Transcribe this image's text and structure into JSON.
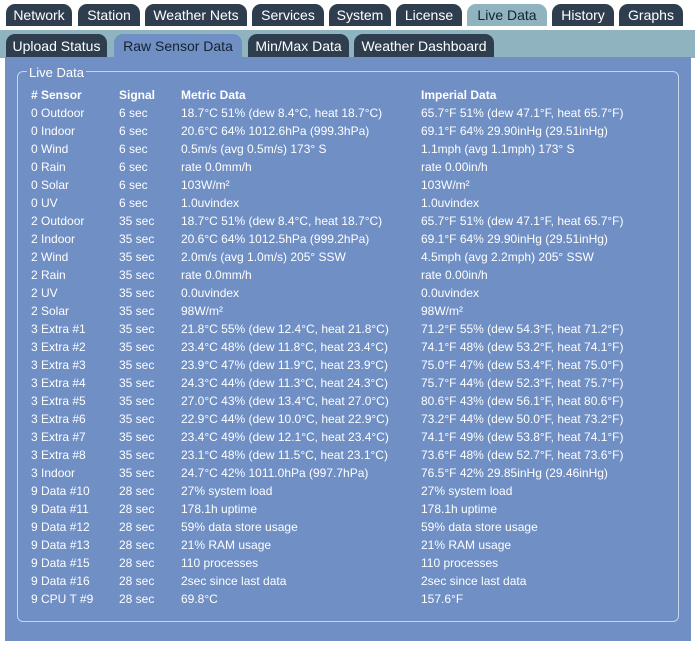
{
  "main_tabs": [
    "Network",
    "Station",
    "Weather Nets",
    "Services",
    "System",
    "License",
    "Live Data",
    "History",
    "Graphs"
  ],
  "active_main_tab": "Live Data",
  "sub_tabs": [
    "Upload Status",
    "Raw Sensor Data",
    "Min/Max Data",
    "Weather Dashboard"
  ],
  "active_sub_tab": "Raw Sensor Data",
  "panel": {
    "legend": "Live Data",
    "headers": {
      "sensor": "# Sensor",
      "signal": "Signal",
      "metric": "Metric Data",
      "imperial": "Imperial Data"
    },
    "rows": [
      {
        "sensor": "0 Outdoor",
        "signal": "6 sec",
        "metric": "18.7°C 51% (dew 8.4°C, heat 18.7°C)",
        "imperial": "65.7°F 51% (dew 47.1°F, heat 65.7°F)"
      },
      {
        "sensor": "0 Indoor",
        "signal": "6 sec",
        "metric": "20.6°C 64% 1012.6hPa (999.3hPa)",
        "imperial": "69.1°F 64% 29.90inHg (29.51inHg)"
      },
      {
        "sensor": "0 Wind",
        "signal": "6 sec",
        "metric": "0.5m/s (avg 0.5m/s) 173° S",
        "imperial": "1.1mph (avg 1.1mph) 173° S"
      },
      {
        "sensor": "0 Rain",
        "signal": "6 sec",
        "metric": "rate 0.0mm/h",
        "imperial": "rate 0.00in/h"
      },
      {
        "sensor": "0 Solar",
        "signal": "6 sec",
        "metric": "103W/m²",
        "imperial": "103W/m²"
      },
      {
        "sensor": "0 UV",
        "signal": "6 sec",
        "metric": "1.0uvindex",
        "imperial": "1.0uvindex"
      },
      {
        "sensor": "2 Outdoor",
        "signal": "35 sec",
        "metric": "18.7°C 51% (dew 8.4°C, heat 18.7°C)",
        "imperial": "65.7°F 51% (dew 47.1°F, heat 65.7°F)"
      },
      {
        "sensor": "2 Indoor",
        "signal": "35 sec",
        "metric": "20.6°C 64% 1012.5hPa (999.2hPa)",
        "imperial": "69.1°F 64% 29.90inHg (29.51inHg)"
      },
      {
        "sensor": "2 Wind",
        "signal": "35 sec",
        "metric": "2.0m/s (avg 1.0m/s) 205° SSW",
        "imperial": "4.5mph (avg 2.2mph) 205° SSW"
      },
      {
        "sensor": "2 Rain",
        "signal": "35 sec",
        "metric": "rate 0.0mm/h",
        "imperial": "rate 0.00in/h"
      },
      {
        "sensor": "2 UV",
        "signal": "35 sec",
        "metric": "0.0uvindex",
        "imperial": "0.0uvindex"
      },
      {
        "sensor": "2 Solar",
        "signal": "35 sec",
        "metric": "98W/m²",
        "imperial": "98W/m²"
      },
      {
        "sensor": "3 Extra #1",
        "signal": "35 sec",
        "metric": "21.8°C 55% (dew 12.4°C, heat 21.8°C)",
        "imperial": "71.2°F 55% (dew 54.3°F, heat 71.2°F)"
      },
      {
        "sensor": "3 Extra #2",
        "signal": "35 sec",
        "metric": "23.4°C 48% (dew 11.8°C, heat 23.4°C)",
        "imperial": "74.1°F 48% (dew 53.2°F, heat 74.1°F)"
      },
      {
        "sensor": "3 Extra #3",
        "signal": "35 sec",
        "metric": "23.9°C 47% (dew 11.9°C, heat 23.9°C)",
        "imperial": "75.0°F 47% (dew 53.4°F, heat 75.0°F)"
      },
      {
        "sensor": "3 Extra #4",
        "signal": "35 sec",
        "metric": "24.3°C 44% (dew 11.3°C, heat 24.3°C)",
        "imperial": "75.7°F 44% (dew 52.3°F, heat 75.7°F)"
      },
      {
        "sensor": "3 Extra #5",
        "signal": "35 sec",
        "metric": "27.0°C 43% (dew 13.4°C, heat 27.0°C)",
        "imperial": "80.6°F 43% (dew 56.1°F, heat 80.6°F)"
      },
      {
        "sensor": "3 Extra #6",
        "signal": "35 sec",
        "metric": "22.9°C 44% (dew 10.0°C, heat 22.9°C)",
        "imperial": "73.2°F 44% (dew 50.0°F, heat 73.2°F)"
      },
      {
        "sensor": "3 Extra #7",
        "signal": "35 sec",
        "metric": "23.4°C 49% (dew 12.1°C, heat 23.4°C)",
        "imperial": "74.1°F 49% (dew 53.8°F, heat 74.1°F)"
      },
      {
        "sensor": "3 Extra #8",
        "signal": "35 sec",
        "metric": "23.1°C 48% (dew 11.5°C, heat 23.1°C)",
        "imperial": "73.6°F 48% (dew 52.7°F, heat 73.6°F)"
      },
      {
        "sensor": "3 Indoor",
        "signal": "35 sec",
        "metric": "24.7°C 42% 1011.0hPa (997.7hPa)",
        "imperial": "76.5°F 42% 29.85inHg (29.46inHg)"
      },
      {
        "sensor": "9 Data #10",
        "signal": "28 sec",
        "metric": "27% system load",
        "imperial": "27% system load"
      },
      {
        "sensor": "9 Data #11",
        "signal": "28 sec",
        "metric": "178.1h uptime",
        "imperial": "178.1h uptime"
      },
      {
        "sensor": "9 Data #12",
        "signal": "28 sec",
        "metric": "59% data store usage",
        "imperial": "59% data store usage"
      },
      {
        "sensor": "9 Data #13",
        "signal": "28 sec",
        "metric": "21% RAM usage",
        "imperial": "21% RAM usage"
      },
      {
        "sensor": "9 Data #15",
        "signal": "28 sec",
        "metric": "110 processes",
        "imperial": "110 processes"
      },
      {
        "sensor": "9 Data #16",
        "signal": "28 sec",
        "metric": "2sec since last data",
        "imperial": "2sec since last data"
      },
      {
        "sensor": "9 CPU T #9",
        "signal": "28 sec",
        "metric": "69.8°C",
        "imperial": "157.6°F"
      }
    ]
  },
  "colors": {
    "tab_dark": "#2f3e4f",
    "tab_active_main": "#8fb4bf",
    "tab_active_sub": "#6f8fc5",
    "panel_bg": "#6f8fc5"
  }
}
